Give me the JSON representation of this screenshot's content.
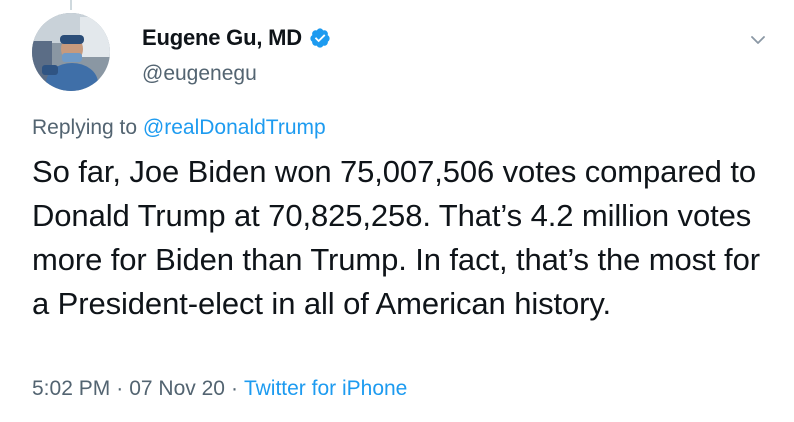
{
  "author": {
    "display_name": "Eugene Gu, MD",
    "handle": "@eugenegu",
    "verified": true
  },
  "reply": {
    "prefix": "Replying to",
    "mention": "@realDonaldTrump"
  },
  "tweet": {
    "text": "So far, Joe Biden won 75,007,506 votes compared to Donald Trump at 70,825,258. That’s 4.2 million votes more for Biden than Trump. In fact, that’s the most for a President-elect in all of American history."
  },
  "meta": {
    "time": "5:02 PM",
    "date": "07 Nov 20",
    "source": "Twitter for iPhone",
    "separator": "·"
  },
  "icons": {
    "verified": "verified-badge-icon",
    "more": "chevron-down-icon"
  },
  "colors": {
    "accent": "#1d9bf0",
    "secondary_text": "#536471",
    "primary_text": "#0f1419"
  }
}
